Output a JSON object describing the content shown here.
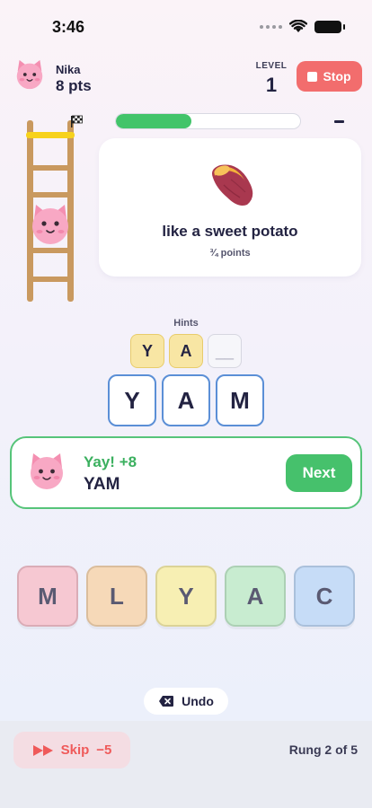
{
  "status_bar": {
    "time": "3:46"
  },
  "header": {
    "player_name": "Nika",
    "player_points": "8 pts",
    "level_label": "LEVEL",
    "level_value": "1",
    "stop_label": "Stop"
  },
  "progress": {
    "fraction": 0.41
  },
  "clue": {
    "text": "like a sweet potato",
    "points": "¾ points",
    "icon": "sweet-potato-icon"
  },
  "hints": {
    "label": "Hints",
    "tiles": [
      "Y",
      "A",
      "__"
    ]
  },
  "answer": {
    "letters": [
      "Y",
      "A",
      "M"
    ]
  },
  "result": {
    "title": "Yay! +8",
    "word": "YAM",
    "next_label": "Next"
  },
  "letter_tiles": [
    {
      "letter": "M",
      "color": "#f6c8d2"
    },
    {
      "letter": "L",
      "color": "#f6d9b8"
    },
    {
      "letter": "Y",
      "color": "#f7efb3"
    },
    {
      "letter": "A",
      "color": "#c8ecd0"
    },
    {
      "letter": "C",
      "color": "#c6dcf7"
    }
  ],
  "undo_label": "Undo",
  "footer": {
    "skip_label": "Skip",
    "skip_penalty": "−5",
    "rung_text": "Rung 2 of 5"
  },
  "colors": {
    "accent_green": "#46c16c",
    "stop_red": "#f26d6d",
    "tile_blue": "#5b8fd6"
  }
}
